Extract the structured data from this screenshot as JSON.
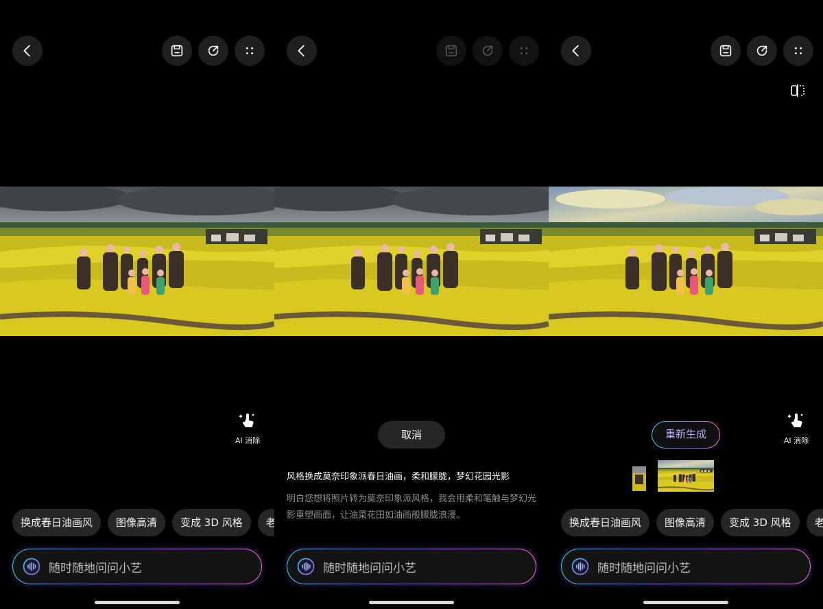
{
  "ask_placeholder": "随时随地问问小艺",
  "ai_erase_label": "AI 消除",
  "suggestions": [
    "换成春日油画风",
    "图像高清",
    "变成 3D 风格",
    "老"
  ],
  "cancel_label": "取消",
  "prompt": "风格换成莫奈印象派春日油画，柔和朦胧，梦幻花园光影",
  "reply": "明白您想将照片转为莫奈印象派风格，我会用柔和笔触与梦幻光影重塑画面，让油菜花田如油画般朦胧浪漫。",
  "regenerate_label": "重新生成",
  "colors": {
    "accent": "#7c6cff",
    "gradient": [
      "#38d6ff",
      "#5b6bff",
      "#b35cff",
      "#ff6ad5"
    ]
  },
  "icons": [
    "back-icon",
    "save-icon",
    "share-icon",
    "more-icon",
    "compare-icon",
    "ai-erase-icon",
    "voice-icon"
  ]
}
